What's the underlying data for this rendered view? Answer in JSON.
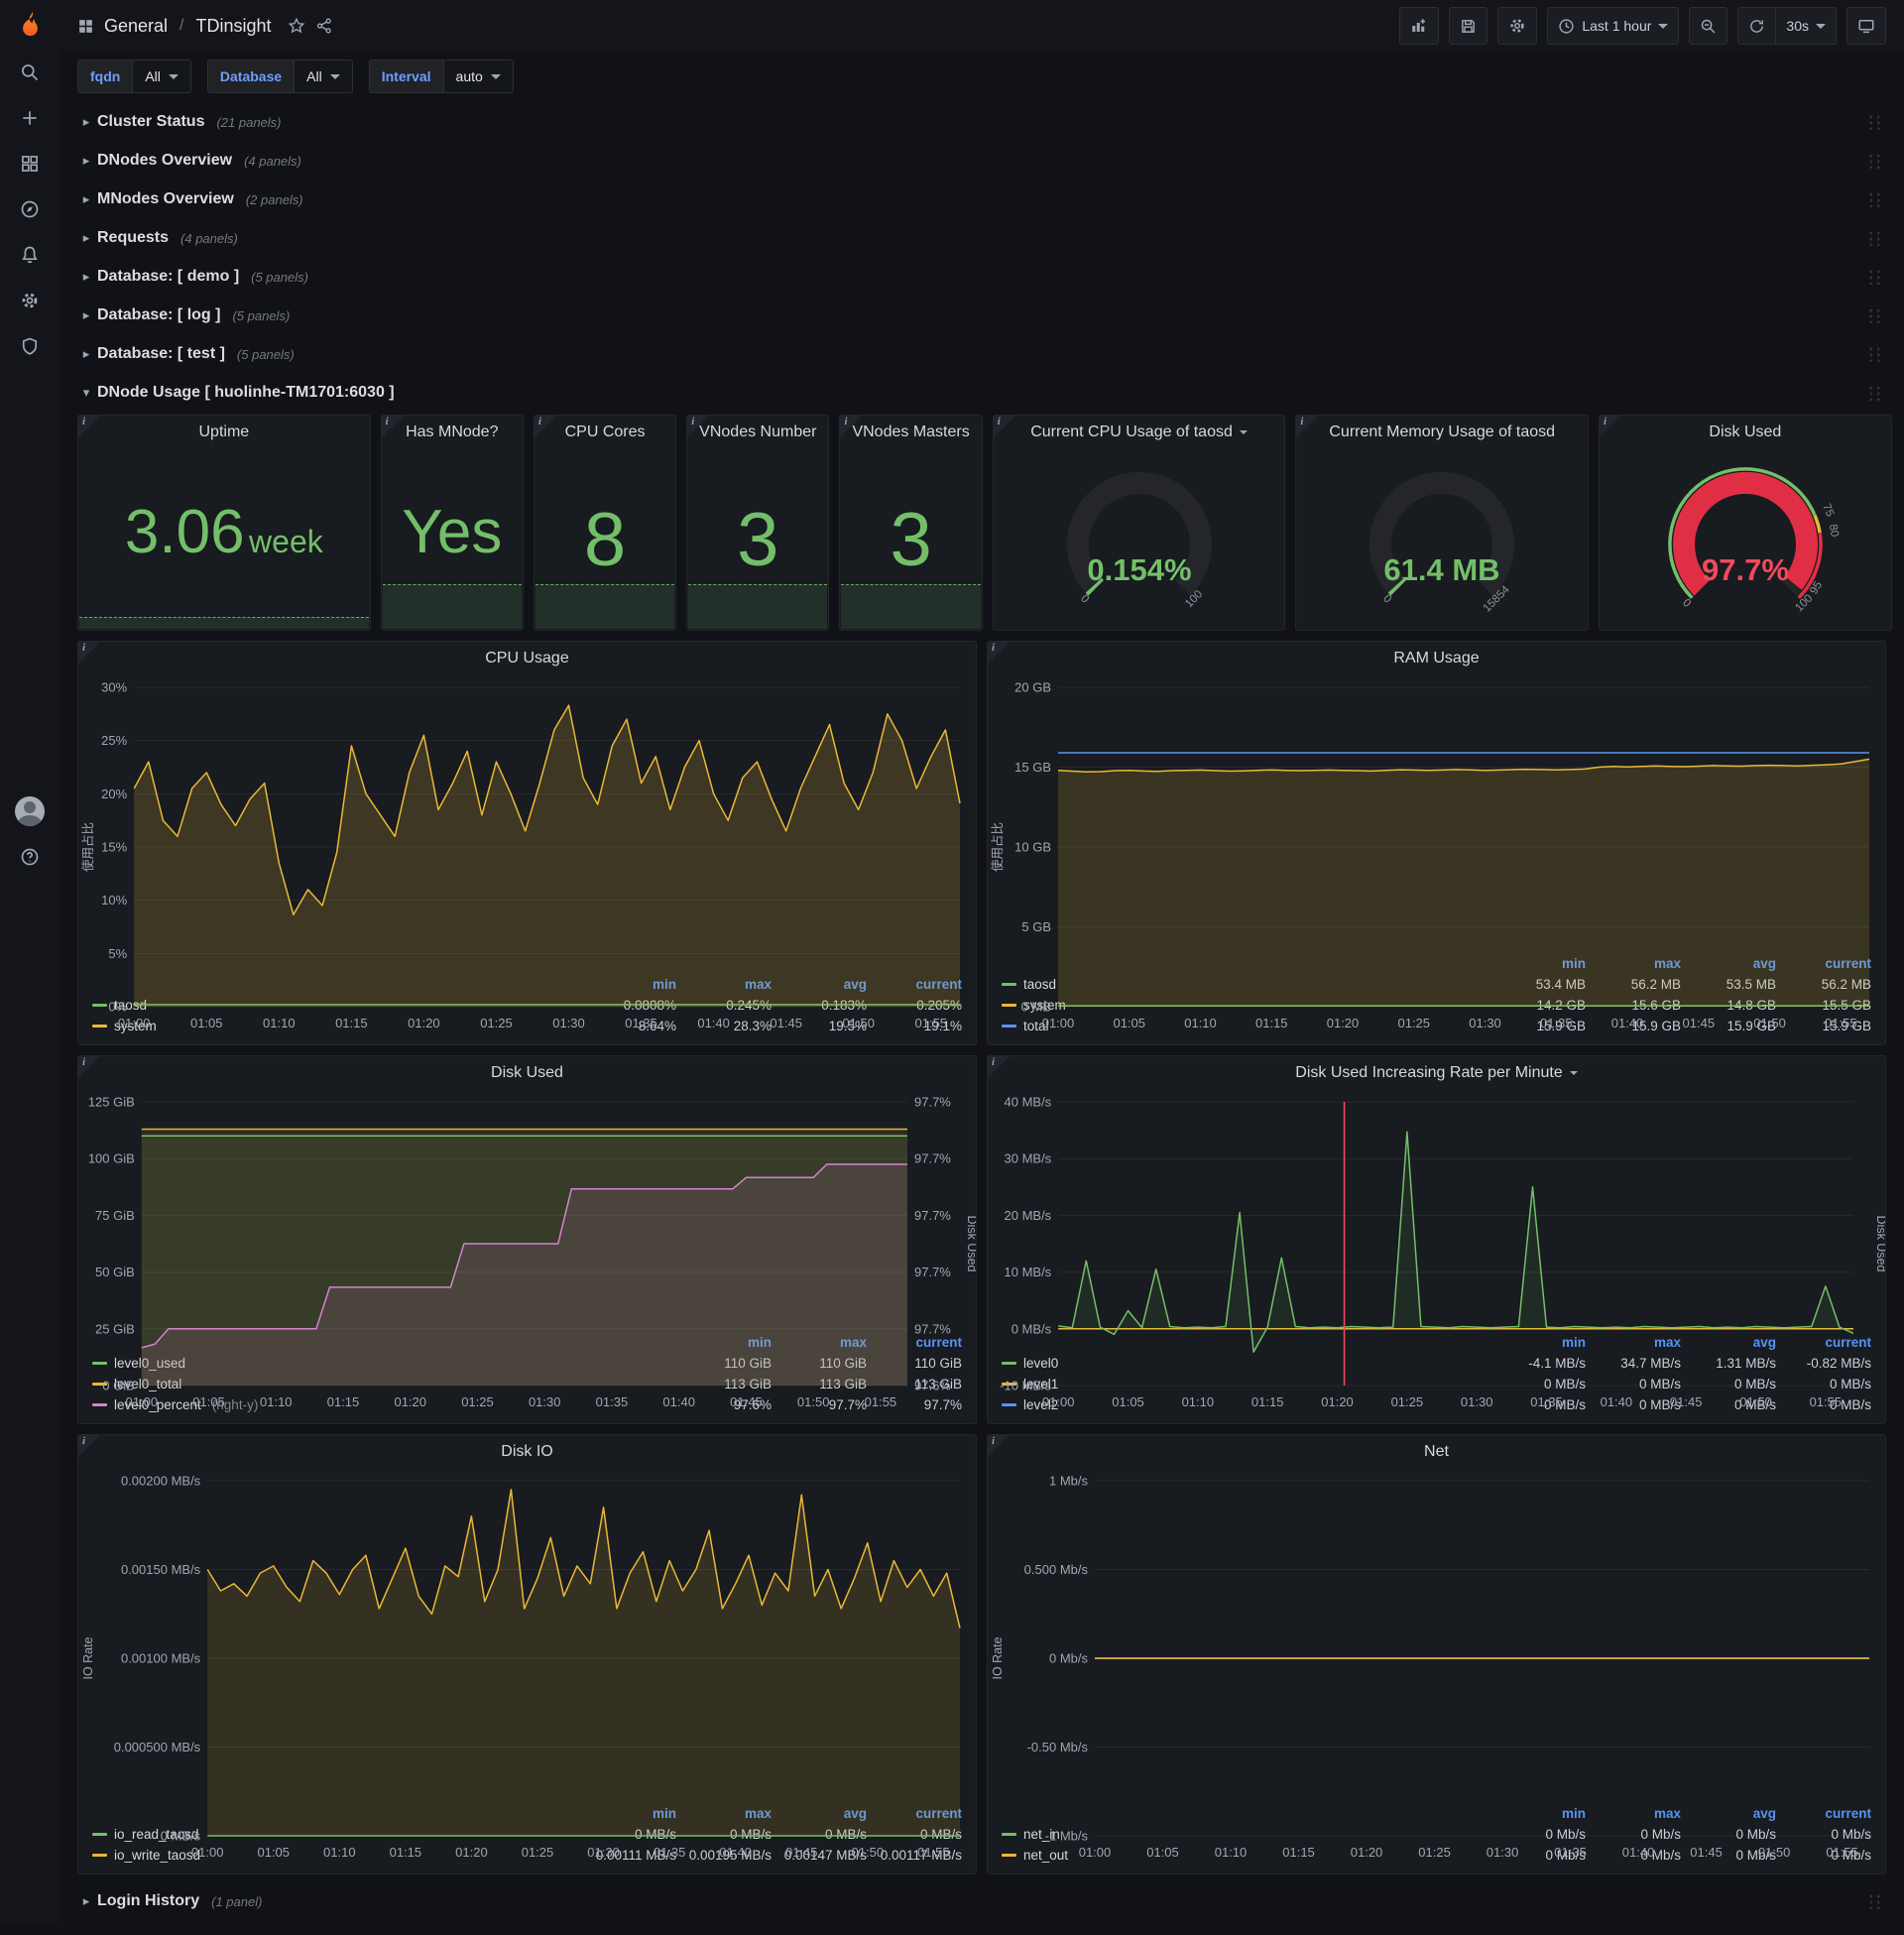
{
  "app": {
    "breadcrumb_section": "General",
    "breadcrumb_sep": "/",
    "breadcrumb_page": "TDinsight",
    "time_range": "Last 1 hour",
    "refresh_interval": "30s"
  },
  "variables": {
    "fqdn_label": "fqdn",
    "fqdn_value": "All",
    "db_label": "Database",
    "db_value": "All",
    "interval_label": "Interval",
    "interval_value": "auto"
  },
  "rows": [
    {
      "title": "Cluster Status",
      "count": "(21 panels)"
    },
    {
      "title": "DNodes Overview",
      "count": "(4 panels)"
    },
    {
      "title": "MNodes Overview",
      "count": "(2 panels)"
    },
    {
      "title": "Requests",
      "count": "(4 panels)"
    },
    {
      "title": "Database: [ demo ]",
      "count": "(5 panels)"
    },
    {
      "title": "Database: [ log ]",
      "count": "(5 panels)"
    },
    {
      "title": "Database: [ test ]",
      "count": "(5 panels)"
    }
  ],
  "dnode_row": {
    "title": "DNode Usage [ huolinhe-TM1701:6030 ]"
  },
  "login_row": {
    "title": "Login History",
    "count": "(1 panel)"
  },
  "stats": {
    "uptime": {
      "title": "Uptime",
      "value": "3.06",
      "unit": "week"
    },
    "has_mnode": {
      "title": "Has MNode?",
      "value": "Yes"
    },
    "cpu_cores": {
      "title": "CPU Cores",
      "value": "8"
    },
    "vnodes_number": {
      "title": "VNodes Number",
      "value": "3"
    },
    "vnodes_masters": {
      "title": "VNodes Masters",
      "value": "3"
    }
  },
  "gauges": {
    "cpu": {
      "title": "Current CPU Usage of taosd",
      "value_text": "0.154%",
      "value_color": "#73bf69",
      "t": 0.0015,
      "arc_color": "#73bf69",
      "labels": [
        {
          "text": "0",
          "t": 0
        },
        {
          "text": "100",
          "t": 1
        }
      ]
    },
    "memory": {
      "title": "Current Memory Usage of taosd",
      "value_text": "61.4 MB",
      "value_color": "#73bf69",
      "t": 0.0039,
      "arc_color": "#73bf69",
      "labels": [
        {
          "text": "0",
          "t": 0
        },
        {
          "text": "15854",
          "t": 1
        }
      ]
    },
    "disk": {
      "title": "Disk Used",
      "value_text": "97.7%",
      "value_color": "#f2495c",
      "t": 0.977,
      "arc_color": "#e02f44",
      "labels": [
        {
          "text": "0",
          "t": 0
        },
        {
          "text": "75",
          "t": 0.75
        },
        {
          "text": "80",
          "t": 0.8
        },
        {
          "text": "95",
          "t": 0.95
        },
        {
          "text": "100",
          "t": 1
        }
      ],
      "ring": [
        {
          "from": 0,
          "to": 0.75,
          "color": "#73bf69"
        },
        {
          "from": 0.75,
          "to": 0.8,
          "color": "#eab839"
        },
        {
          "from": 0.8,
          "to": 1,
          "color": "#e02f44"
        }
      ]
    }
  },
  "chart_data": {
    "cpu_usage": {
      "type": "line",
      "title": "CPU Usage",
      "ylabel": "使用占比",
      "y": {
        "min": 0,
        "max": 30,
        "ticks": [
          "0%",
          "5%",
          "10%",
          "15%",
          "20%",
          "25%",
          "30%"
        ]
      },
      "x_labels": [
        "01:00",
        "01:05",
        "01:10",
        "01:15",
        "01:20",
        "01:25",
        "01:30",
        "01:35",
        "01:40",
        "01:45",
        "01:50",
        "01:55"
      ],
      "series": [
        {
          "name": "taosd",
          "color": "#73bf69",
          "fill": 0.1,
          "const": 0.2,
          "n": 58
        },
        {
          "name": "system",
          "color": "#eab839",
          "fill": 0.18,
          "values": [
            20.5,
            23,
            17.5,
            16,
            20.5,
            22,
            19,
            17,
            19.5,
            21,
            13.5,
            8.64,
            11,
            9.5,
            14.5,
            24.5,
            20,
            18,
            16,
            22,
            25.5,
            18.5,
            21,
            24,
            18,
            23,
            20,
            16.5,
            21,
            26,
            28.3,
            21.5,
            19,
            24.5,
            27,
            21,
            23.5,
            18.5,
            22.5,
            25,
            20,
            17.5,
            21.5,
            23,
            19.5,
            16.5,
            20.5,
            23.5,
            26.5,
            21,
            18.5,
            22,
            27.5,
            25,
            20.5,
            23.5,
            26,
            19.1
          ]
        }
      ],
      "legend": {
        "columns": [
          "min",
          "max",
          "avg",
          "current"
        ],
        "rows": [
          {
            "name": "taosd",
            "color": "#73bf69",
            "values": [
              "0.0808%",
              "0.245%",
              "0.183%",
              "0.205%"
            ]
          },
          {
            "name": "system",
            "color": "#eab839",
            "values": [
              "8.64%",
              "28.3%",
              "19.5%",
              "19.1%"
            ]
          }
        ]
      }
    },
    "ram_usage": {
      "type": "line",
      "title": "RAM Usage",
      "ylabel": "使用占比",
      "y": {
        "min": 0,
        "max": 20,
        "ticks": [
          "0 MB",
          "5 GB",
          "10 GB",
          "15 GB",
          "20 GB"
        ]
      },
      "x_labels": [
        "01:00",
        "01:05",
        "01:10",
        "01:15",
        "01:20",
        "01:25",
        "01:30",
        "01:35",
        "01:40",
        "01:45",
        "01:50",
        "01:55"
      ],
      "series": [
        {
          "name": "taosd",
          "color": "#73bf69",
          "fill": 0.1,
          "const": 0.054,
          "n": 58
        },
        {
          "name": "system",
          "color": "#eab839",
          "fill": 0.16,
          "values": [
            14.8,
            14.75,
            14.7,
            14.72,
            14.78,
            14.8,
            14.76,
            14.74,
            14.78,
            14.8,
            14.82,
            14.78,
            14.75,
            14.77,
            14.8,
            14.83,
            14.8,
            14.78,
            14.8,
            14.82,
            14.8,
            14.78,
            14.76,
            14.8,
            14.84,
            14.82,
            14.8,
            14.82,
            14.85,
            14.83,
            14.8,
            14.82,
            14.85,
            14.87,
            14.85,
            14.83,
            14.85,
            14.88,
            15,
            15.05,
            15.02,
            15.05,
            15.08,
            15.05,
            15.03,
            15.06,
            15.1,
            15.08,
            15.06,
            15.1,
            15.12,
            15.1,
            15.08,
            15.12,
            15.15,
            15.2,
            15.35,
            15.5
          ]
        },
        {
          "name": "total",
          "color": "#5794f2",
          "fill": 0,
          "const": 15.9,
          "n": 58
        }
      ],
      "legend": {
        "columns": [
          "min",
          "max",
          "avg",
          "current"
        ],
        "rows": [
          {
            "name": "taosd",
            "color": "#73bf69",
            "values": [
              "53.4 MB",
              "56.2 MB",
              "53.5 MB",
              "56.2 MB"
            ]
          },
          {
            "name": "system",
            "color": "#eab839",
            "values": [
              "14.2 GB",
              "15.6 GB",
              "14.8 GB",
              "15.5 GB"
            ]
          },
          {
            "name": "total",
            "color": "#5794f2",
            "values": [
              "15.9 GB",
              "15.9 GB",
              "15.9 GB",
              "15.9 GB"
            ]
          }
        ]
      }
    },
    "disk_used": {
      "type": "line",
      "title": "Disk Used",
      "ylabel_right": "Disk Used",
      "y": {
        "min": 0,
        "max": 125,
        "ticks": [
          "0 GiB",
          "25 GiB",
          "50 GiB",
          "75 GiB",
          "100 GiB",
          "125 GiB"
        ]
      },
      "y2": {
        "min": 97.58,
        "max": 97.73,
        "ticks": [
          "97.6%",
          "97.7%",
          "97.7%",
          "97.7%",
          "97.7%",
          "97.7%"
        ]
      },
      "x_labels": [
        "01:00",
        "01:05",
        "01:10",
        "01:15",
        "01:20",
        "01:25",
        "01:30",
        "01:35",
        "01:40",
        "01:45",
        "01:50",
        "01:55"
      ],
      "series": [
        {
          "name": "level0_used",
          "color": "#73bf69",
          "fill": 0.12,
          "const": 110,
          "n": 58
        },
        {
          "name": "level0_total",
          "color": "#eab839",
          "fill": 0.1,
          "const": 113,
          "n": 58
        },
        {
          "name": "level0_percent",
          "color": "#d683ce",
          "fill": 0.12,
          "axis": 2,
          "values": [
            97.6,
            97.602,
            97.61,
            97.61,
            97.61,
            97.61,
            97.61,
            97.61,
            97.61,
            97.61,
            97.61,
            97.61,
            97.61,
            97.61,
            97.632,
            97.632,
            97.632,
            97.632,
            97.632,
            97.632,
            97.632,
            97.632,
            97.632,
            97.632,
            97.655,
            97.655,
            97.655,
            97.655,
            97.655,
            97.655,
            97.655,
            97.655,
            97.684,
            97.684,
            97.684,
            97.684,
            97.684,
            97.684,
            97.684,
            97.684,
            97.684,
            97.684,
            97.684,
            97.684,
            97.684,
            97.69,
            97.69,
            97.69,
            97.69,
            97.69,
            97.69,
            97.697,
            97.697,
            97.697,
            97.697,
            97.697,
            97.697,
            97.697
          ]
        }
      ],
      "legend": {
        "columns": [
          "min",
          "max",
          "current"
        ],
        "rows": [
          {
            "name": "level0_used",
            "color": "#73bf69",
            "values": [
              "110 GiB",
              "110 GiB",
              "110 GiB"
            ]
          },
          {
            "name": "level0_total",
            "color": "#eab839",
            "values": [
              "113 GiB",
              "113 GiB",
              "113 GiB"
            ]
          },
          {
            "name": "level0_percent",
            "suffix": "(right-y)",
            "color": "#d683ce",
            "values": [
              "97.6%",
              "97.7%",
              "97.7%"
            ]
          }
        ]
      }
    },
    "disk_rate": {
      "type": "line",
      "title": "Disk Used Increasing Rate per Minute",
      "ylabel_right": "Disk Used",
      "y": {
        "min": -10,
        "max": 40,
        "ticks": [
          "-10 MB/s",
          "0 MB/s",
          "10 MB/s",
          "20 MB/s",
          "30 MB/s",
          "40 MB/s"
        ]
      },
      "x_labels": [
        "01:00",
        "01:05",
        "01:10",
        "01:15",
        "01:20",
        "01:25",
        "01:30",
        "01:35",
        "01:40",
        "01:45",
        "01:50",
        "01:55"
      ],
      "annotation": {
        "x": 20.5,
        "color": "#f2495c"
      },
      "series": [
        {
          "name": "level2",
          "color": "#5794f2",
          "fill": 0,
          "const": 0,
          "n": 58
        },
        {
          "name": "level1",
          "color": "#eab839",
          "fill": 0,
          "const": 0,
          "n": 58
        },
        {
          "name": "level0",
          "color": "#73bf69",
          "fill": 0.1,
          "values": [
            0.5,
            0.2,
            12,
            0.3,
            -1,
            3.2,
            0.2,
            10.5,
            0.4,
            0.2,
            0.3,
            0.2,
            0.4,
            20.5,
            -4.1,
            0.3,
            12.5,
            0.4,
            0.2,
            0.3,
            0.2,
            0.4,
            0.3,
            0.2,
            0.3,
            34.7,
            0.4,
            0.3,
            0.2,
            0.4,
            0.3,
            0.2,
            0.3,
            0.4,
            25,
            0.3,
            0.2,
            0.4,
            0.3,
            0.2,
            0.3,
            0.2,
            0.4,
            0.3,
            0.2,
            0.3,
            0.4,
            0.2,
            0.3,
            0.2,
            0.4,
            0.3,
            0.2,
            0.3,
            0.4,
            7.5,
            0.3,
            -0.82
          ]
        }
      ],
      "legend": {
        "columns": [
          "min",
          "max",
          "avg",
          "current"
        ],
        "rows": [
          {
            "name": "level0",
            "color": "#73bf69",
            "values": [
              "-4.1 MB/s",
              "34.7 MB/s",
              "1.31 MB/s",
              "-0.82 MB/s"
            ]
          },
          {
            "name": "level1",
            "color": "#eab839",
            "values": [
              "0 MB/s",
              "0 MB/s",
              "0 MB/s",
              "0 MB/s"
            ]
          },
          {
            "name": "level2",
            "color": "#5794f2",
            "values": [
              "0 MB/s",
              "0 MB/s",
              "0 MB/s",
              "0 MB/s"
            ]
          }
        ]
      }
    },
    "disk_io": {
      "type": "line",
      "title": "Disk IO",
      "ylabel": "IO Rate",
      "y": {
        "min": 0,
        "max": 0.002,
        "ticks": [
          "0 MB/s",
          "0.000500 MB/s",
          "0.00100 MB/s",
          "0.00150 MB/s",
          "0.00200 MB/s"
        ]
      },
      "x_labels": [
        "01:00",
        "01:05",
        "01:10",
        "01:15",
        "01:20",
        "01:25",
        "01:30",
        "01:35",
        "01:40",
        "01:45",
        "01:50",
        "01:55"
      ],
      "series": [
        {
          "name": "io_read_taosd",
          "color": "#73bf69",
          "fill": 0.08,
          "const": 0,
          "n": 58
        },
        {
          "name": "io_write_taosd",
          "color": "#eab839",
          "fill": 0.14,
          "values": [
            0.0015,
            0.00138,
            0.00142,
            0.00135,
            0.00148,
            0.00152,
            0.0014,
            0.00132,
            0.00155,
            0.00148,
            0.00136,
            0.0015,
            0.00158,
            0.00128,
            0.00145,
            0.00162,
            0.00135,
            0.00125,
            0.00152,
            0.00146,
            0.0018,
            0.00132,
            0.0015,
            0.00195,
            0.00128,
            0.00145,
            0.00168,
            0.00135,
            0.00152,
            0.00142,
            0.00185,
            0.00128,
            0.00148,
            0.0016,
            0.00132,
            0.00155,
            0.00138,
            0.0015,
            0.00172,
            0.00128,
            0.00142,
            0.00158,
            0.0013,
            0.00148,
            0.00138,
            0.00192,
            0.00135,
            0.0015,
            0.00128,
            0.00145,
            0.00165,
            0.00132,
            0.00155,
            0.0014,
            0.0015,
            0.00135,
            0.00148,
            0.00117
          ]
        }
      ],
      "legend": {
        "columns": [
          "min",
          "max",
          "avg",
          "current"
        ],
        "rows": [
          {
            "name": "io_read_taosd",
            "color": "#73bf69",
            "values": [
              "0 MB/s",
              "0 MB/s",
              "0 MB/s",
              "0 MB/s"
            ]
          },
          {
            "name": "io_write_taosd",
            "color": "#eab839",
            "values": [
              "0.00111 MB/s",
              "0.00195 MB/s",
              "0.00147 MB/s",
              "0.00117 MB/s"
            ]
          }
        ]
      }
    },
    "net": {
      "type": "line",
      "title": "Net",
      "ylabel": "IO Rate",
      "y": {
        "min": -1,
        "max": 1,
        "ticks": [
          "-1 Mb/s",
          "-0.50 Mb/s",
          "0 Mb/s",
          "0.500 Mb/s",
          "1 Mb/s"
        ]
      },
      "x_labels": [
        "01:00",
        "01:05",
        "01:10",
        "01:15",
        "01:20",
        "01:25",
        "01:30",
        "01:35",
        "01:40",
        "01:45",
        "01:50",
        "01:55"
      ],
      "series": [
        {
          "name": "net_in",
          "color": "#73bf69",
          "fill": 0,
          "const": 0,
          "n": 58
        },
        {
          "name": "net_out",
          "color": "#eab839",
          "fill": 0,
          "const": 0,
          "n": 58
        }
      ],
      "legend": {
        "columns": [
          "min",
          "max",
          "avg",
          "current"
        ],
        "rows": [
          {
            "name": "net_in",
            "color": "#73bf69",
            "values": [
              "0 Mb/s",
              "0 Mb/s",
              "0 Mb/s",
              "0 Mb/s"
            ]
          },
          {
            "name": "net_out",
            "color": "#eab839",
            "values": [
              "0 Mb/s",
              "0 Mb/s",
              "0 Mb/s",
              "0 Mb/s"
            ]
          }
        ]
      }
    }
  }
}
